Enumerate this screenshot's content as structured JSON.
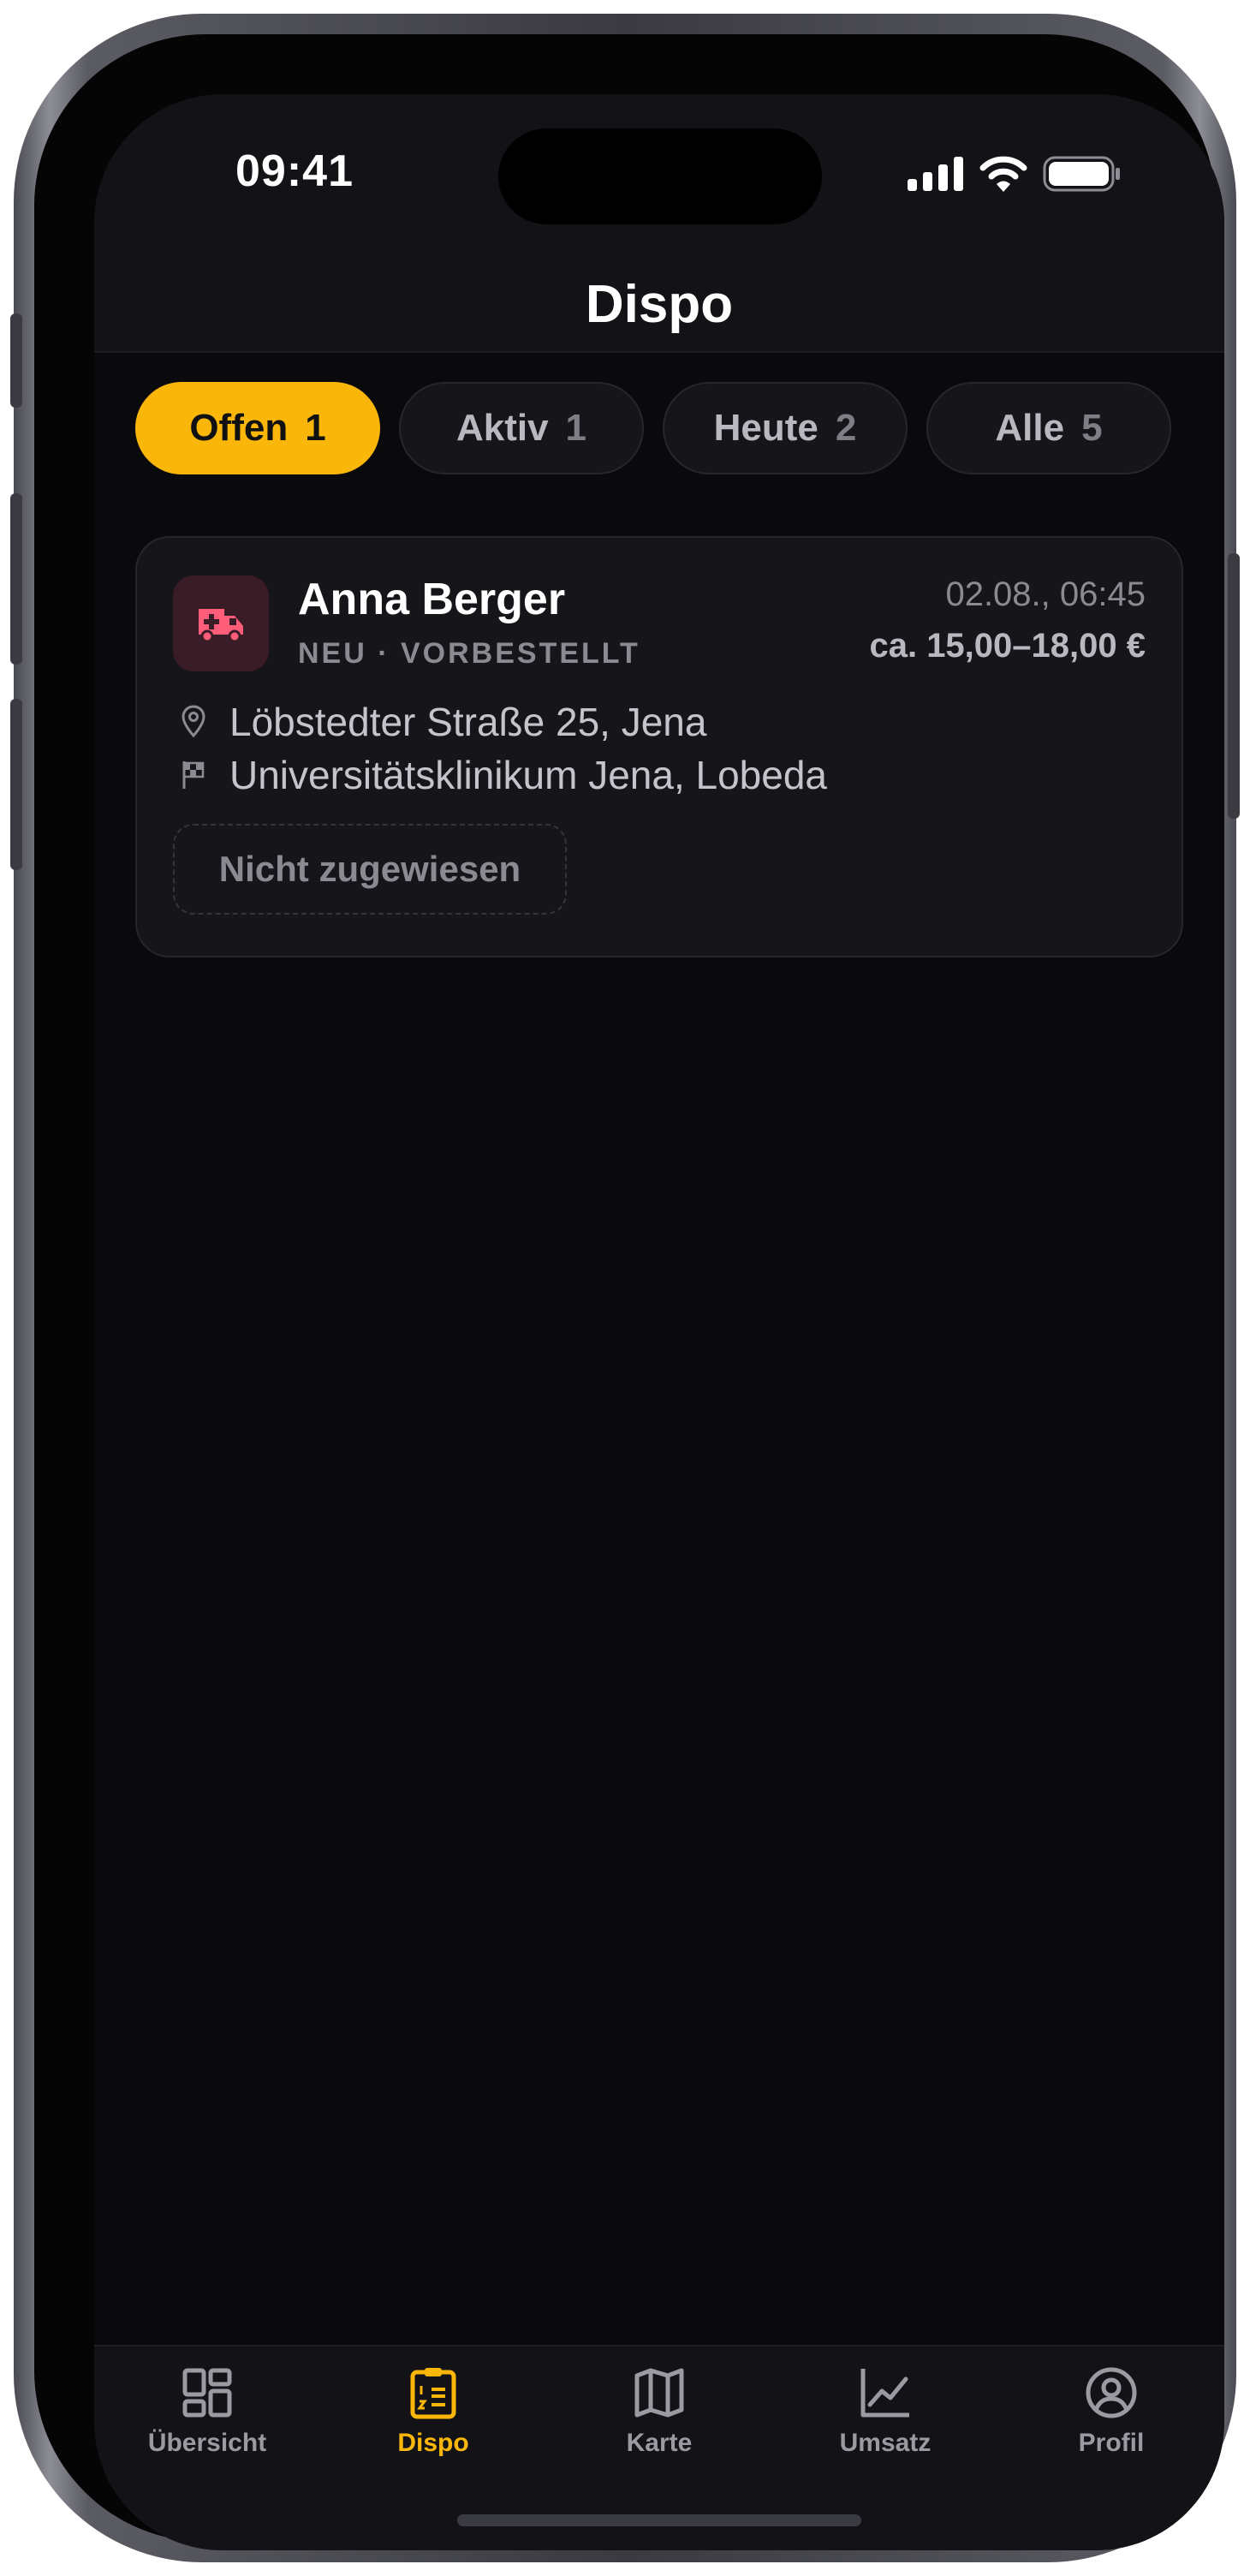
{
  "status_bar": {
    "time": "09:41"
  },
  "header": {
    "title": "Dispo"
  },
  "filters": [
    {
      "label": "Offen",
      "count": "1",
      "active": true
    },
    {
      "label": "Aktiv",
      "count": "1",
      "active": false
    },
    {
      "label": "Heute",
      "count": "2",
      "active": false
    },
    {
      "label": "Alle",
      "count": "5",
      "active": false
    }
  ],
  "order": {
    "icon": "ambulance-icon",
    "name": "Anna Berger",
    "status": "NEU · VORBESTELLT",
    "datetime": "02.08., 06:45",
    "price": "ca. 15,00–18,00 €",
    "from": "Löbstedter Straße 25, Jena",
    "to": "Universitätsklinikum Jena, Lobeda",
    "assignment": "Nicht zugewiesen"
  },
  "tabbar": [
    {
      "label": "Übersicht",
      "icon": "dashboard-icon",
      "active": false
    },
    {
      "label": "Dispo",
      "icon": "clipboard-list-icon",
      "active": true
    },
    {
      "label": "Karte",
      "icon": "map-icon",
      "active": false
    },
    {
      "label": "Umsatz",
      "icon": "line-chart-icon",
      "active": false
    },
    {
      "label": "Profil",
      "icon": "user-circle-icon",
      "active": false
    }
  ],
  "colors": {
    "accent": "#fbb60a",
    "background": "#0a0a0c",
    "card": "#16161a",
    "ambulance_tile": "#3a1c26",
    "ambulance_icon": "#ff5d7a"
  }
}
